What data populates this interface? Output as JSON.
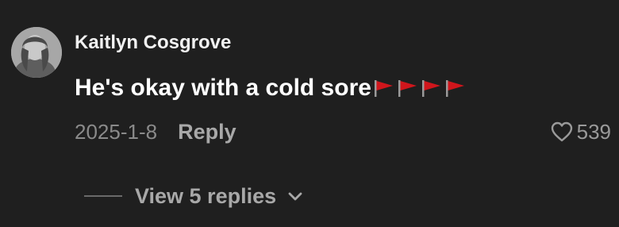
{
  "comment": {
    "author": "Kaitlyn Cosgrove",
    "text": "He's okay with a cold sore",
    "emoji": [
      "red-flag-icon",
      "red-flag-icon",
      "red-flag-icon",
      "red-flag-icon"
    ],
    "date": "2025-1-8",
    "reply_label": "Reply",
    "like_count": "539",
    "view_replies_label": "View 5 replies"
  },
  "colors": {
    "background": "#1f1f1f",
    "text_primary": "#ffffff",
    "text_secondary": "#8a8a8a",
    "flag_red": "#d0161c"
  }
}
